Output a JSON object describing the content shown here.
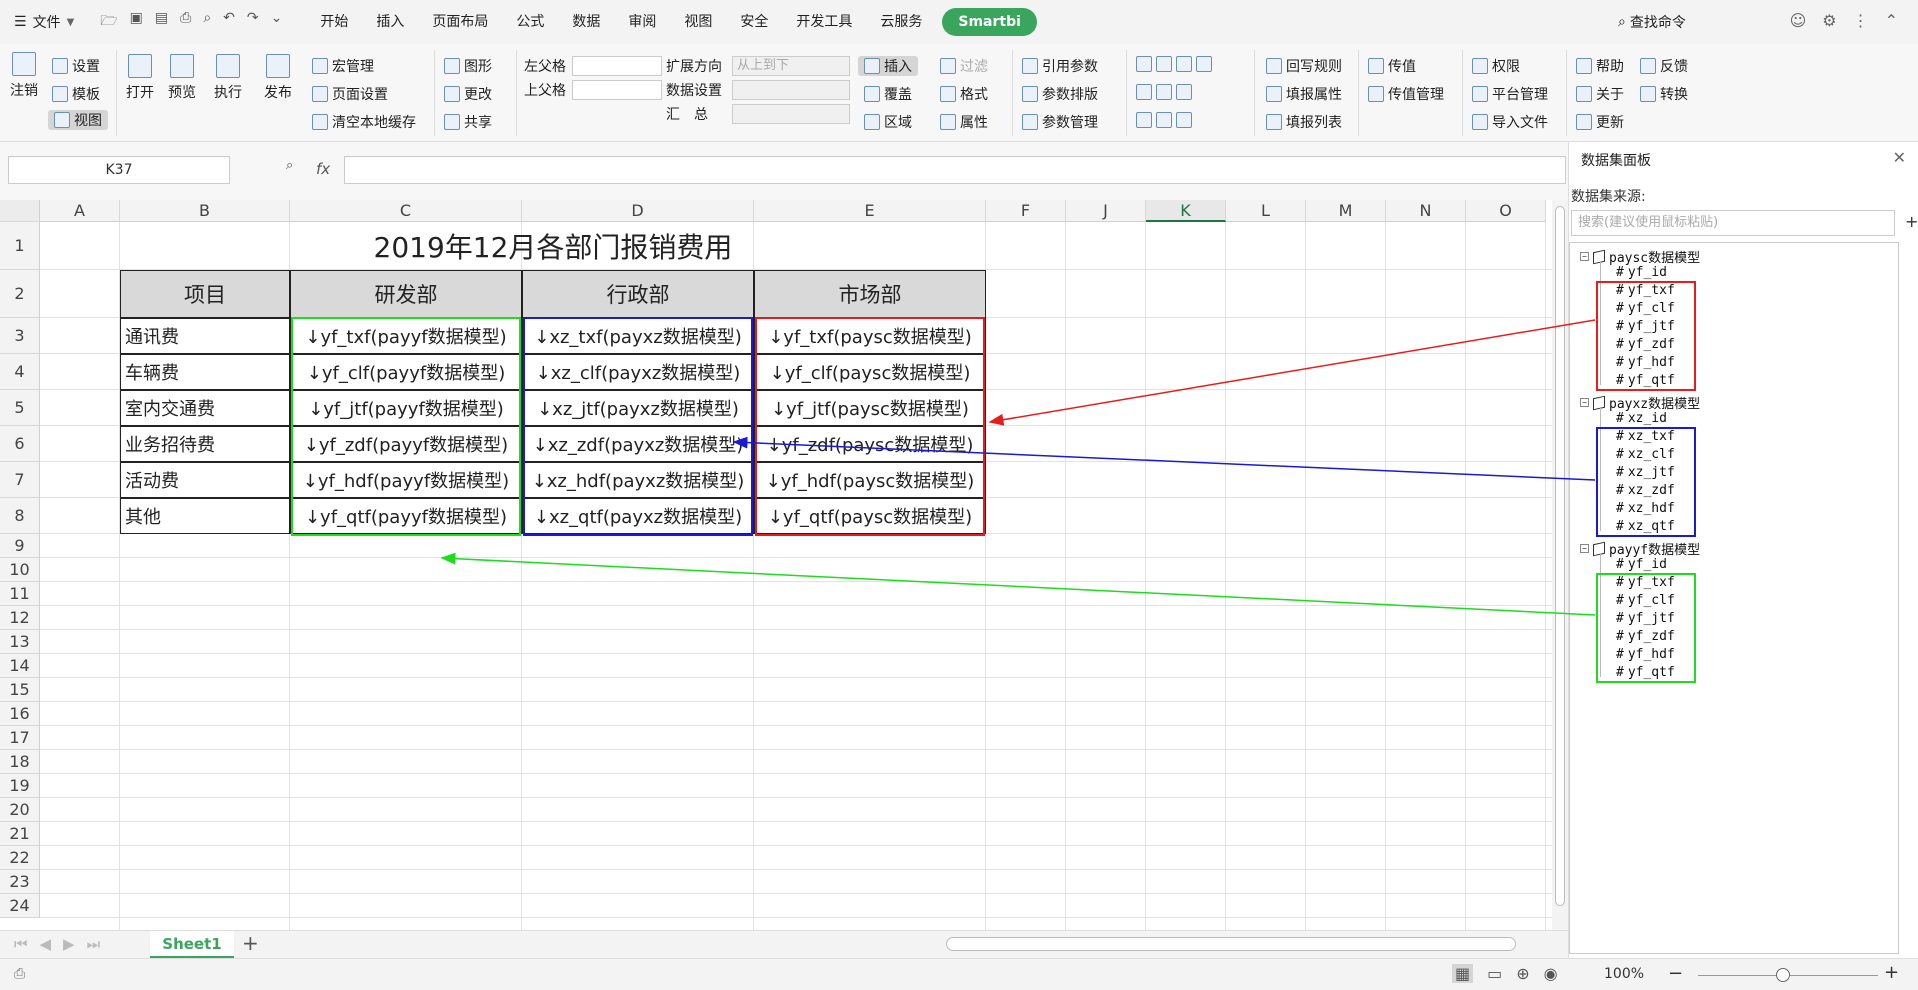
{
  "menubar": {
    "file_label": "文件",
    "tabs": [
      "开始",
      "插入",
      "页面布局",
      "公式",
      "数据",
      "审阅",
      "视图",
      "安全",
      "开发工具",
      "云服务"
    ],
    "smartbi_label": "Smartbi",
    "search_label": "查找命令"
  },
  "ribbon": {
    "logout": "注销",
    "settings": "设置",
    "template": "模板",
    "view": "视图",
    "open": "打开",
    "preview": "预览",
    "execute": "执行",
    "publish": "发布",
    "macro": "宏管理",
    "page_setup": "页面设置",
    "clear_cache": "清空本地缓存",
    "shape": "图形",
    "change": "更改",
    "share": "共享",
    "left_parent": "左父格",
    "top_parent": "上父格",
    "expand_dir": "扩展方向",
    "expand_value": "从上到下",
    "data_setting": "数据设置",
    "summary": "汇　总",
    "insert": "插入",
    "cover": "覆盖",
    "region": "区域",
    "filter": "过滤",
    "format": "格式",
    "property": "属性",
    "ref_param": "引用参数",
    "param_layout": "参数排版",
    "param_mgmt": "参数管理",
    "writeback_rule": "回写规则",
    "fill_property": "填报属性",
    "fill_list": "填报列表",
    "pass_value": "传值",
    "pass_value_mgmt": "传值管理",
    "permission": "权限",
    "platform_mgmt": "平台管理",
    "import_file": "导入文件",
    "help": "帮助",
    "feedback": "反馈",
    "about": "关于",
    "convert": "转换",
    "update": "更新"
  },
  "formula_bar": {
    "name_box": "K37",
    "fx": "fx",
    "value": ""
  },
  "columns": [
    "A",
    "B",
    "C",
    "D",
    "E",
    "F",
    "J",
    "K",
    "L",
    "M",
    "N",
    "O"
  ],
  "selected_column": "K",
  "rows": [
    "1",
    "2",
    "3",
    "4",
    "5",
    "6",
    "7",
    "8",
    "9",
    "10",
    "11",
    "12",
    "13",
    "14",
    "15",
    "16",
    "17",
    "18",
    "19",
    "20",
    "21",
    "22",
    "23",
    "24"
  ],
  "sheet": {
    "title": "2019年12月各部门报销费用",
    "headers": [
      "项目",
      "研发部",
      "行政部",
      "市场部"
    ],
    "table_rows": [
      [
        "通讯费",
        "↓yf_txf(payyf数据模型)",
        "↓xz_txf(payxz数据模型)",
        "↓yf_txf(paysc数据模型)"
      ],
      [
        "车辆费",
        "↓yf_clf(payyf数据模型)",
        "↓xz_clf(payxz数据模型)",
        "↓yf_clf(paysc数据模型)"
      ],
      [
        "室内交通费",
        "↓yf_jtf(payyf数据模型)",
        "↓xz_jtf(payxz数据模型)",
        "↓yf_jtf(paysc数据模型)"
      ],
      [
        "业务招待费",
        "↓yf_zdf(payyf数据模型)",
        "↓xz_zdf(payxz数据模型)",
        "↓yf_zdf(paysc数据模型)"
      ],
      [
        "活动费",
        "↓yf_hdf(payyf数据模型)",
        "↓xz_hdf(payxz数据模型)",
        "↓yf_hdf(paysc数据模型)"
      ],
      [
        "其他",
        "↓yf_qtf(payyf数据模型)",
        "↓xz_qtf(payxz数据模型)",
        "↓yf_qtf(paysc数据模型)"
      ]
    ]
  },
  "sheet_tabs": {
    "active": "Sheet1",
    "add": "+"
  },
  "status": {
    "zoom": "100%"
  },
  "panel": {
    "title": "数据集面板",
    "source_label": "数据集来源:",
    "search_placeholder": "搜索(建议使用鼠标粘贴)",
    "models": [
      {
        "name": "paysc数据模型",
        "fields": [
          "yf_id",
          "yf_txf",
          "yf_clf",
          "yf_jtf",
          "yf_zdf",
          "yf_hdf",
          "yf_qtf"
        ]
      },
      {
        "name": "payxz数据模型",
        "fields": [
          "xz_id",
          "xz_txf",
          "xz_clf",
          "xz_jtf",
          "xz_zdf",
          "xz_hdf",
          "xz_qtf"
        ]
      },
      {
        "name": "payyf数据模型",
        "fields": [
          "yf_id",
          "yf_txf",
          "yf_clf",
          "yf_jtf",
          "yf_zdf",
          "yf_hdf",
          "yf_qtf"
        ]
      }
    ]
  },
  "colors": {
    "red": "#e81c1c",
    "blue": "#1a1ad6",
    "green": "#1edc1e",
    "accent": "#3aa55c"
  }
}
